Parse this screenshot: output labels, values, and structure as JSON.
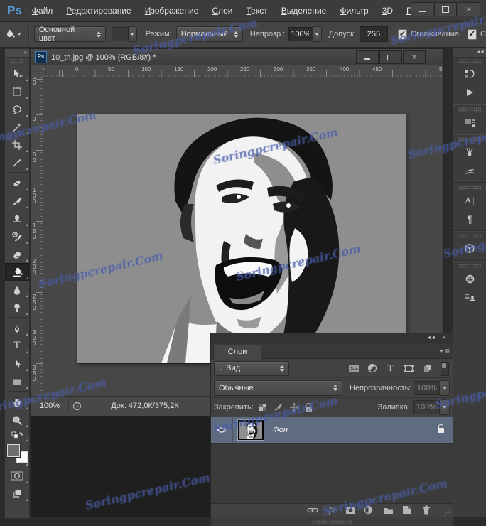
{
  "menubar": {
    "logo": "Ps",
    "items": [
      "Файл",
      "Редактирование",
      "Изображение",
      "Слои",
      "Текст",
      "Выделение",
      "Фильтр",
      "3D",
      "Г"
    ]
  },
  "options": {
    "fill_source_value": "Основной цвет",
    "mode_label": "Режим:",
    "mode_value": "Нормальный",
    "opacity_label": "Непрозр.:",
    "opacity_value": "100%",
    "tolerance_label": "Допуск:",
    "tolerance_value": "255",
    "antialias_label": "Сглаживание",
    "contiguous_label_partial": "С"
  },
  "document": {
    "tab_logo": "Ps",
    "title": "10_tn.jpg @ 100% (RGB/8#) *"
  },
  "rulers": {
    "horizontal": [
      "50",
      "0",
      "50",
      "100",
      "150",
      "200",
      "250",
      "300",
      "350",
      "400",
      "450",
      "5"
    ],
    "vertical": [
      "50",
      "0",
      "50",
      "100",
      "150",
      "200",
      "250",
      "300",
      "350"
    ]
  },
  "statusbar": {
    "zoom": "100%",
    "doc_info": "Док: 472,0К/375,2К"
  },
  "layers_panel": {
    "tab": "Слои",
    "filter_value": "Вид",
    "blend_mode_value": "Обычные",
    "opacity_label": "Непрозрачность:",
    "opacity_value": "100%",
    "lock_label": "Закрепить:",
    "fill_label": "Заливка:",
    "fill_value": "100%",
    "layer_name": "Фон"
  },
  "glyphs": {
    "collapse_left": "◄◄",
    "collapse_right": "»",
    "panel_menu": "≡",
    "close": "×",
    "minimize": "–",
    "check": "✓",
    "type": "T",
    "character": "A",
    "paragraph": "¶",
    "fx": "fx",
    "search": "⌕"
  },
  "watermark": {
    "text": "Soringpcrepair.Com"
  },
  "colors": {
    "selected_layer_row": "#5f6c80",
    "canvas_gray": "#8e8e8e",
    "watermark_blue": "#3e509e",
    "ps_logo_blue": "#5aa7e8"
  }
}
